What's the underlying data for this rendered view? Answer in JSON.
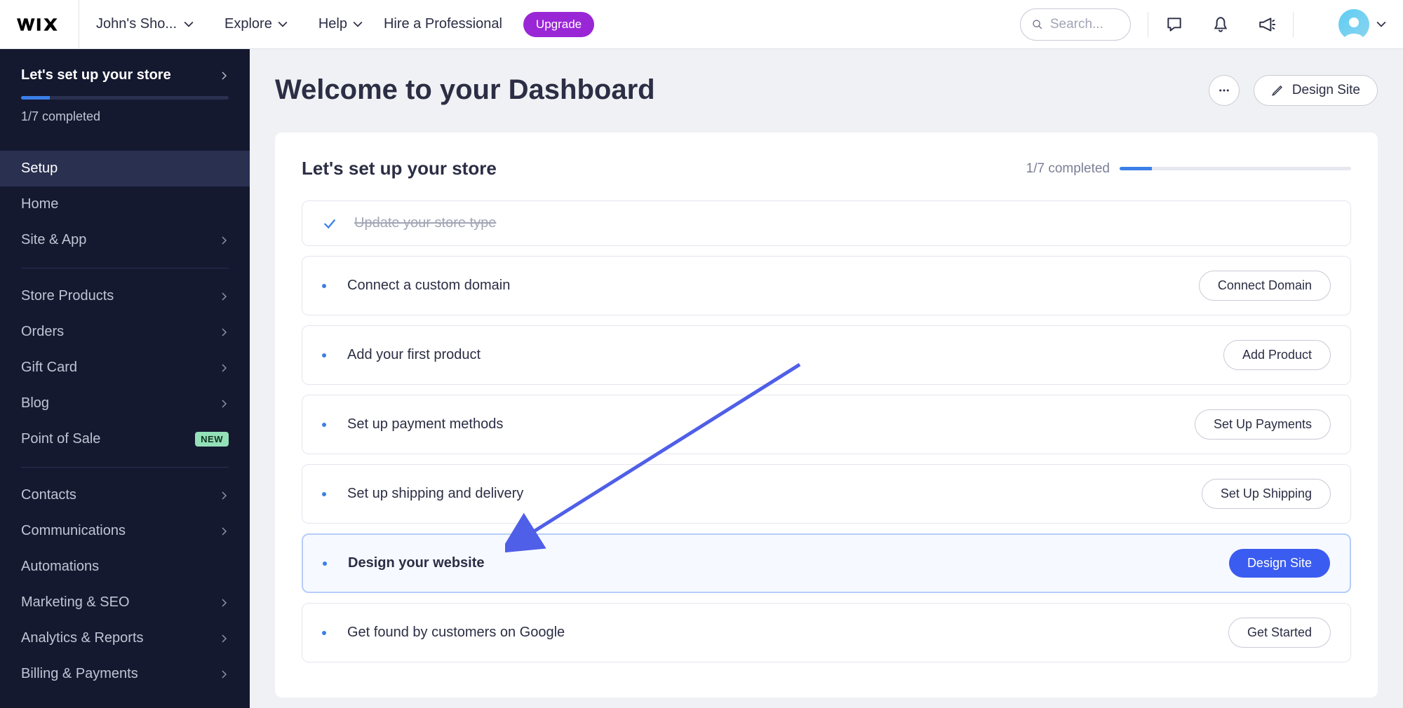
{
  "topbar": {
    "site_name": "John's Sho...",
    "explore": "Explore",
    "help": "Help",
    "hire": "Hire a Professional",
    "upgrade": "Upgrade",
    "search_placeholder": "Search..."
  },
  "sidebar": {
    "title": "Let's set up your store",
    "completed": "1/7 completed",
    "items": [
      {
        "label": "Setup",
        "active": true
      },
      {
        "label": "Home"
      },
      {
        "label": "Site & App",
        "chev": true
      },
      {
        "label": "Store Products",
        "chev": true
      },
      {
        "label": "Orders",
        "chev": true
      },
      {
        "label": "Gift Card",
        "chev": true
      },
      {
        "label": "Blog",
        "chev": true
      },
      {
        "label": "Point of Sale",
        "badge": "NEW"
      },
      {
        "label": "Contacts",
        "chev": true
      },
      {
        "label": "Communications",
        "chev": true
      },
      {
        "label": "Automations"
      },
      {
        "label": "Marketing & SEO",
        "chev": true
      },
      {
        "label": "Analytics & Reports",
        "chev": true
      },
      {
        "label": "Billing & Payments",
        "chev": true
      }
    ]
  },
  "main": {
    "welcome": "Welcome to your Dashboard",
    "design_site": "Design Site",
    "card_title": "Let's set up your store",
    "card_completed": "1/7 completed"
  },
  "steps": [
    {
      "title": "Update your store type",
      "done": true
    },
    {
      "title": "Connect a custom domain",
      "action": "Connect Domain"
    },
    {
      "title": "Add your first product",
      "action": "Add Product"
    },
    {
      "title": "Set up payment methods",
      "action": "Set Up Payments"
    },
    {
      "title": "Set up shipping and delivery",
      "action": "Set Up Shipping"
    },
    {
      "title": "Design your website",
      "action": "Design Site",
      "highlight": true,
      "primary": true
    },
    {
      "title": "Get found by customers on Google",
      "action": "Get Started"
    }
  ]
}
